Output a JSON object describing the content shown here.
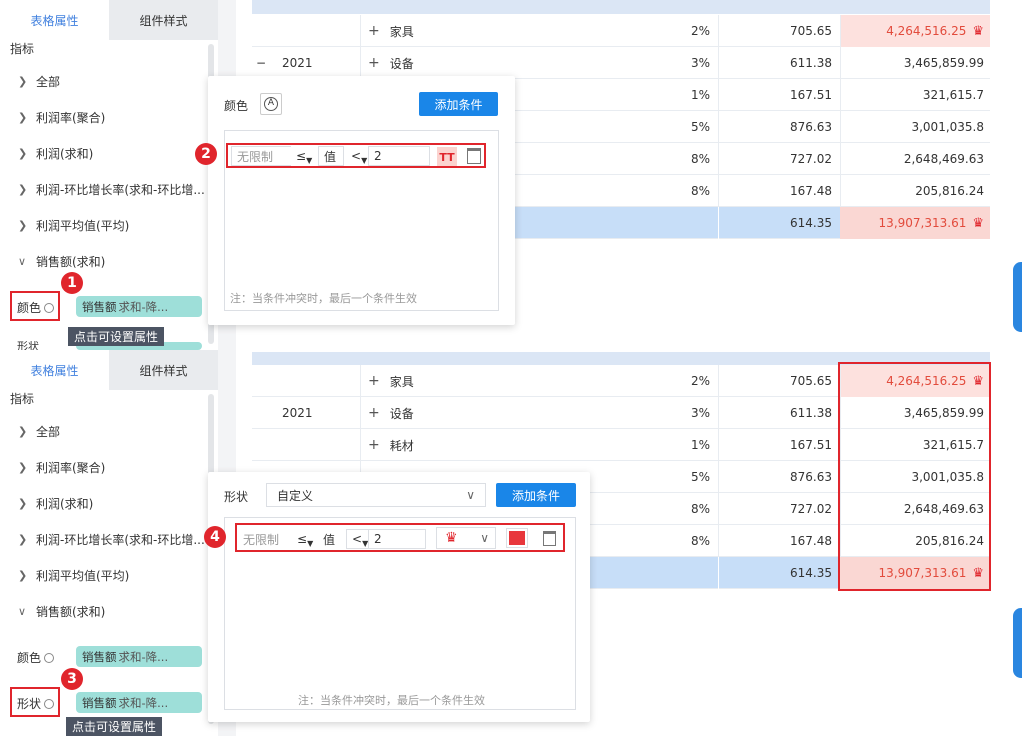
{
  "left_panel": {
    "tabs": [
      "表格属性",
      "组件样式"
    ],
    "section": "指标",
    "tree": [
      "全部",
      "利润率(聚合)",
      "利润(求和)",
      "利润-环比增长率(求和-环比增...",
      "利润平均值(平均)",
      "销售额(求和)"
    ],
    "tree2": [
      "全部",
      "利润率(聚合)",
      "利润(求和)",
      "利润-环比增长率(求和-环比增...",
      "利润平均值(平均)",
      "销售额(求和)"
    ],
    "color_label": "颜色",
    "shape_label": "形状",
    "pill_main": "销售额",
    "pill_sub": "求和-降...",
    "tooltip": "点击可设置属性",
    "badges": [
      "1",
      "2",
      "3",
      "4"
    ]
  },
  "table1": {
    "rows": [
      {
        "year": "",
        "category": "家具",
        "pct": "2%",
        "avg": "705.65",
        "sales": "4,264,516.25",
        "highlight": true
      },
      {
        "year": "2021",
        "category": "设备",
        "pct": "3%",
        "avg": "611.38",
        "sales": "3,465,859.99",
        "highlight": false
      },
      {
        "year": "",
        "category": "",
        "pct": "1%",
        "avg": "167.51",
        "sales": "321,615.7",
        "highlight": false
      },
      {
        "year": "",
        "category": "",
        "pct": "5%",
        "avg": "876.63",
        "sales": "3,001,035.8",
        "highlight": false
      },
      {
        "year": "",
        "category": "",
        "pct": "8%",
        "avg": "727.02",
        "sales": "2,648,469.63",
        "highlight": false
      },
      {
        "year": "",
        "category": "",
        "pct": "8%",
        "avg": "167.48",
        "sales": "205,816.24",
        "highlight": false
      }
    ],
    "total": {
      "avg": "614.35",
      "sales": "13,907,313.61"
    }
  },
  "table2": {
    "rows": [
      {
        "year": "",
        "category": "家具",
        "pct": "2%",
        "avg": "705.65",
        "sales": "4,264,516.25",
        "highlight": true
      },
      {
        "year": "2021",
        "category": "设备",
        "pct": "3%",
        "avg": "611.38",
        "sales": "3,465,859.99",
        "highlight": false
      },
      {
        "year": "",
        "category": "耗材",
        "pct": "1%",
        "avg": "167.51",
        "sales": "321,615.7",
        "highlight": false
      },
      {
        "year": "",
        "category": "",
        "pct": "5%",
        "avg": "876.63",
        "sales": "3,001,035.8",
        "highlight": false
      },
      {
        "year": "",
        "category": "",
        "pct": "8%",
        "avg": "727.02",
        "sales": "2,648,469.63",
        "highlight": false
      },
      {
        "year": "",
        "category": "",
        "pct": "8%",
        "avg": "167.48",
        "sales": "205,816.24",
        "highlight": false
      }
    ],
    "total": {
      "avg": "614.35",
      "sales": "13,907,313.61"
    }
  },
  "popup1": {
    "label": "颜色",
    "add_button": "添加条件",
    "cond_unlimited": "无限制",
    "cond_op1": "≤",
    "cond_value_label": "值",
    "cond_op2": "<",
    "cond_value": "2",
    "note": "注：当条件冲突时，最后一个条件生效"
  },
  "popup2": {
    "label": "形状",
    "select_value": "自定义",
    "add_button": "添加条件",
    "cond_unlimited": "无限制",
    "cond_op1": "≤",
    "cond_value_label": "值",
    "cond_op2": "<",
    "cond_value": "2",
    "note": "注：当条件冲突时，最后一个条件生效"
  },
  "colors": {
    "accent": "#1a86e8",
    "alert_red": "#e0252c",
    "pill": "#9edfd9",
    "highlight_pink": "#fde1de",
    "total_blue": "#c7def8"
  }
}
